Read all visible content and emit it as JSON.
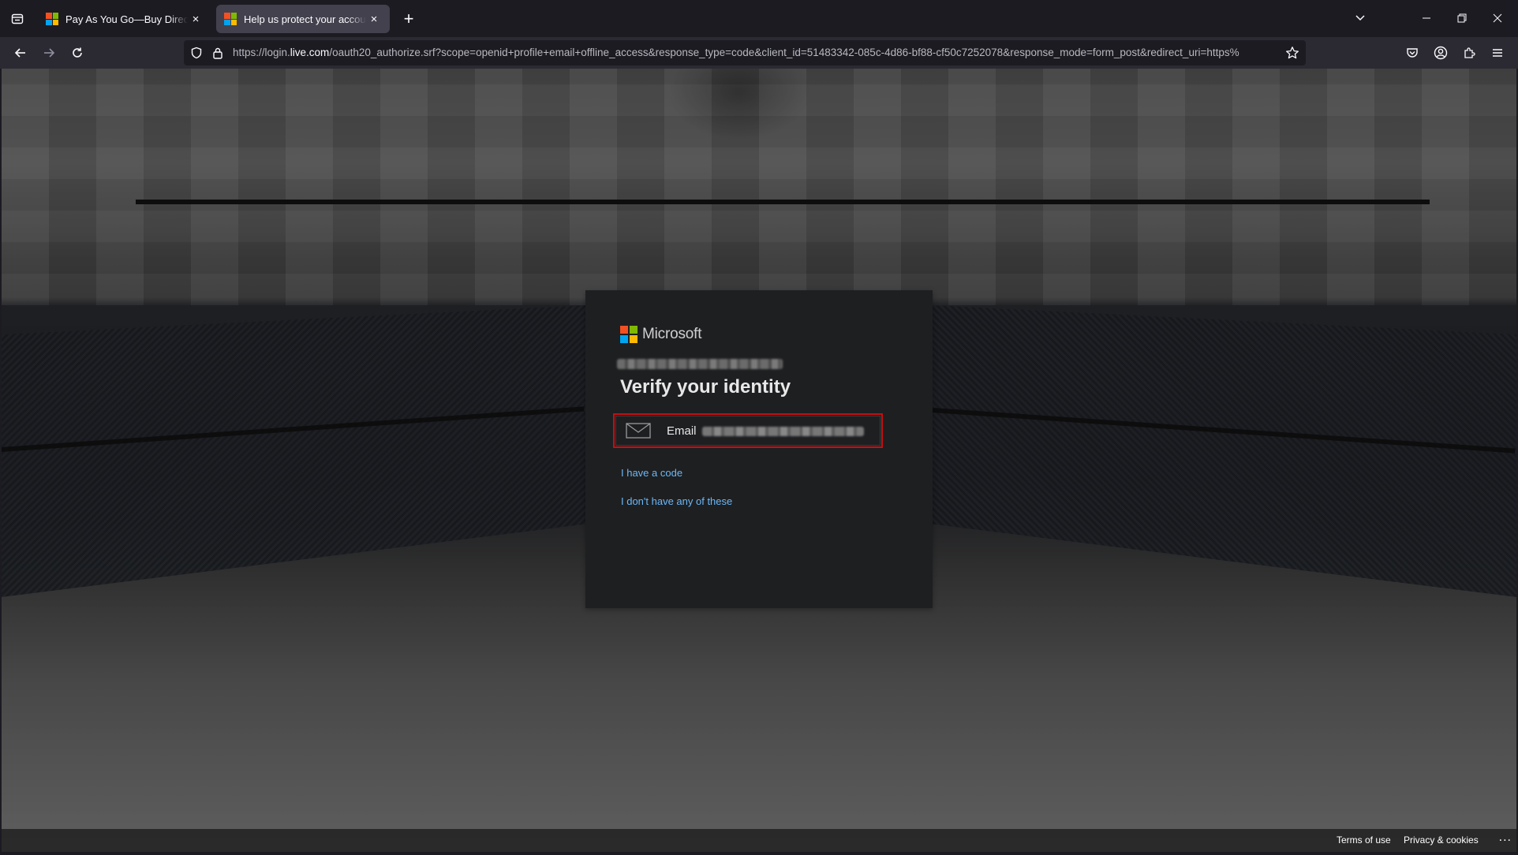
{
  "tabs": [
    {
      "title": "Pay As You Go—Buy Directly | M",
      "close": "×"
    },
    {
      "title": "Help us protect your account",
      "close": "×"
    }
  ],
  "new_tab": "+",
  "url": {
    "prefix": "https://login.",
    "domain": "live.com",
    "rest": "/oauth20_authorize.srf?scope=openid+profile+email+offline_access&response_type=code&client_id=51483342-085c-4d86-bf88-cf50c7252078&response_mode=form_post&redirect_uri=https%"
  },
  "card": {
    "brand": "Microsoft",
    "heading": "Verify your identity",
    "email_option_label": "Email",
    "link_have_code": "I have a code",
    "link_none": "I don't have any of these"
  },
  "footer": {
    "terms": "Terms of use",
    "privacy": "Privacy & cookies",
    "more": "..."
  },
  "colors": {
    "accent_link": "#6cb8f6",
    "highlight_border": "#c40f12",
    "ms_red": "#f25022",
    "ms_green": "#7fba00",
    "ms_blue": "#00a4ef",
    "ms_yellow": "#ffb900"
  }
}
